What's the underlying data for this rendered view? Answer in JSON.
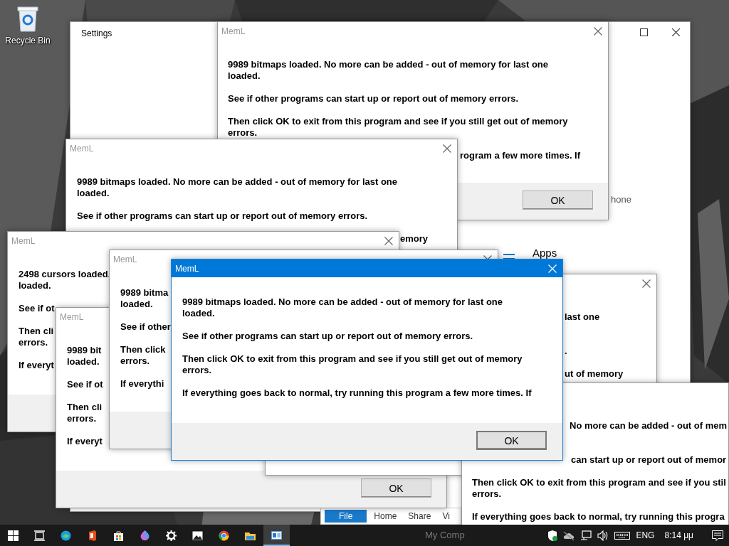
{
  "desktop": {
    "icons": [
      {
        "label": "Recycle Bin"
      }
    ]
  },
  "settings": {
    "title": "Settings",
    "texts": [
      "hone",
      "Apps"
    ]
  },
  "explorer": {
    "tabs": [
      {
        "label": "File",
        "selected": true
      },
      {
        "label": "Home",
        "selected": false
      },
      {
        "label": "Share",
        "selected": false
      },
      {
        "label": "Vi",
        "selected": false
      }
    ],
    "address": "My Comp"
  },
  "dialogs": [
    {
      "title": "MemL",
      "active": false,
      "paragraphs": [
        [
          "9989 bitmaps loaded. No more can be added - out of memory for last one",
          "loaded."
        ],
        [
          "See if other programs can start up or report out of memory errors."
        ],
        [
          "Then click OK to exit from this program and see if you still get out of memory",
          "errors."
        ],
        [
          "rogram a few more times. If"
        ]
      ],
      "button": "OK"
    },
    {
      "title": "MemL",
      "active": false,
      "paragraphs": [
        [
          "9989 bitmaps loaded. No more can be added - out of memory for last one",
          "loaded."
        ],
        [
          "See if other programs can start up or report out of memory errors."
        ],
        [
          "emory"
        ]
      ]
    },
    {
      "title": "MemL",
      "active": false,
      "paragraphs": [
        [
          "2498 cursors loaded.",
          "loaded."
        ],
        [
          "See if ot"
        ],
        [
          "Then cli",
          "errors."
        ],
        [
          "If everyt"
        ]
      ]
    },
    {
      "title": "MemL",
      "active": false,
      "paragraphs": [
        [
          "9989 bit",
          "loaded."
        ],
        [
          "See if ot"
        ],
        [
          "Then cli",
          "errors."
        ],
        [
          "If everyt"
        ]
      ],
      "button": "OK"
    },
    {
      "title": "MemL",
      "active": false,
      "paragraphs": [
        [
          "9989 bitma",
          "loaded."
        ],
        [
          "See if other"
        ],
        [
          "Then click",
          "errors."
        ],
        [
          "If everythi"
        ]
      ]
    },
    {
      "active": false,
      "paragraphs": [
        [
          "last one"
        ],
        [
          "."
        ],
        [
          "ut of memory"
        ]
      ]
    },
    {
      "active": false,
      "paragraphs": [
        [
          "No more can be added - out of mem"
        ],
        [
          "can start up or report out of memor"
        ],
        [
          "Then click OK to exit from this program and see if you stil",
          "errors."
        ],
        [
          "If everything goes back to normal, try running this progra"
        ]
      ]
    },
    {
      "title": "MemL",
      "active": true,
      "paragraphs": [
        [
          "9989 bitmaps loaded. No more can be added - out of memory for last one",
          "loaded."
        ],
        [
          "See if other programs can start up or report out of memory errors."
        ],
        [
          "Then click OK to exit from this program and see if you still get out of memory",
          "errors."
        ],
        [
          "If everything goes back to normal, try running this program a few more times. If"
        ]
      ],
      "button": "OK"
    }
  ],
  "taskbar": {
    "apps": [
      {
        "kind": "start",
        "active": false
      },
      {
        "kind": "taskview",
        "active": false
      },
      {
        "kind": "edge",
        "active": false
      },
      {
        "kind": "office",
        "active": false
      },
      {
        "kind": "store",
        "active": false
      },
      {
        "kind": "paint",
        "active": false
      },
      {
        "kind": "settings",
        "active": false
      },
      {
        "kind": "photos",
        "active": false
      },
      {
        "kind": "chrome",
        "active": false
      },
      {
        "kind": "folder",
        "active": false
      },
      {
        "kind": "window",
        "active": true
      }
    ],
    "tray": [
      {
        "kind": "shield"
      },
      {
        "kind": "cloud"
      },
      {
        "kind": "network"
      },
      {
        "kind": "volume"
      },
      {
        "kind": "keyboard"
      }
    ],
    "language": "ENG",
    "clock": "8:14 μμ"
  }
}
